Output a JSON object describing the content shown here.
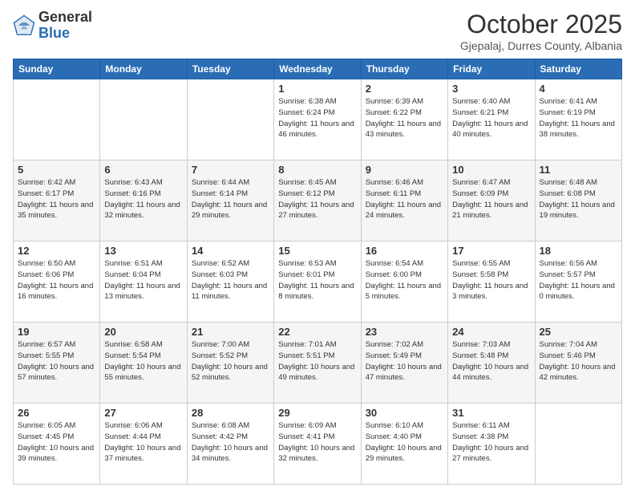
{
  "logo": {
    "general": "General",
    "blue": "Blue"
  },
  "header": {
    "month": "October 2025",
    "location": "Gjepalaj, Durres County, Albania"
  },
  "days_of_week": [
    "Sunday",
    "Monday",
    "Tuesday",
    "Wednesday",
    "Thursday",
    "Friday",
    "Saturday"
  ],
  "weeks": [
    [
      {
        "day": null,
        "data": null
      },
      {
        "day": null,
        "data": null
      },
      {
        "day": null,
        "data": null
      },
      {
        "day": "1",
        "data": "Sunrise: 6:38 AM\nSunset: 6:24 PM\nDaylight: 11 hours and 46 minutes."
      },
      {
        "day": "2",
        "data": "Sunrise: 6:39 AM\nSunset: 6:22 PM\nDaylight: 11 hours and 43 minutes."
      },
      {
        "day": "3",
        "data": "Sunrise: 6:40 AM\nSunset: 6:21 PM\nDaylight: 11 hours and 40 minutes."
      },
      {
        "day": "4",
        "data": "Sunrise: 6:41 AM\nSunset: 6:19 PM\nDaylight: 11 hours and 38 minutes."
      }
    ],
    [
      {
        "day": "5",
        "data": "Sunrise: 6:42 AM\nSunset: 6:17 PM\nDaylight: 11 hours and 35 minutes."
      },
      {
        "day": "6",
        "data": "Sunrise: 6:43 AM\nSunset: 6:16 PM\nDaylight: 11 hours and 32 minutes."
      },
      {
        "day": "7",
        "data": "Sunrise: 6:44 AM\nSunset: 6:14 PM\nDaylight: 11 hours and 29 minutes."
      },
      {
        "day": "8",
        "data": "Sunrise: 6:45 AM\nSunset: 6:12 PM\nDaylight: 11 hours and 27 minutes."
      },
      {
        "day": "9",
        "data": "Sunrise: 6:46 AM\nSunset: 6:11 PM\nDaylight: 11 hours and 24 minutes."
      },
      {
        "day": "10",
        "data": "Sunrise: 6:47 AM\nSunset: 6:09 PM\nDaylight: 11 hours and 21 minutes."
      },
      {
        "day": "11",
        "data": "Sunrise: 6:48 AM\nSunset: 6:08 PM\nDaylight: 11 hours and 19 minutes."
      }
    ],
    [
      {
        "day": "12",
        "data": "Sunrise: 6:50 AM\nSunset: 6:06 PM\nDaylight: 11 hours and 16 minutes."
      },
      {
        "day": "13",
        "data": "Sunrise: 6:51 AM\nSunset: 6:04 PM\nDaylight: 11 hours and 13 minutes."
      },
      {
        "day": "14",
        "data": "Sunrise: 6:52 AM\nSunset: 6:03 PM\nDaylight: 11 hours and 11 minutes."
      },
      {
        "day": "15",
        "data": "Sunrise: 6:53 AM\nSunset: 6:01 PM\nDaylight: 11 hours and 8 minutes."
      },
      {
        "day": "16",
        "data": "Sunrise: 6:54 AM\nSunset: 6:00 PM\nDaylight: 11 hours and 5 minutes."
      },
      {
        "day": "17",
        "data": "Sunrise: 6:55 AM\nSunset: 5:58 PM\nDaylight: 11 hours and 3 minutes."
      },
      {
        "day": "18",
        "data": "Sunrise: 6:56 AM\nSunset: 5:57 PM\nDaylight: 11 hours and 0 minutes."
      }
    ],
    [
      {
        "day": "19",
        "data": "Sunrise: 6:57 AM\nSunset: 5:55 PM\nDaylight: 10 hours and 57 minutes."
      },
      {
        "day": "20",
        "data": "Sunrise: 6:58 AM\nSunset: 5:54 PM\nDaylight: 10 hours and 55 minutes."
      },
      {
        "day": "21",
        "data": "Sunrise: 7:00 AM\nSunset: 5:52 PM\nDaylight: 10 hours and 52 minutes."
      },
      {
        "day": "22",
        "data": "Sunrise: 7:01 AM\nSunset: 5:51 PM\nDaylight: 10 hours and 49 minutes."
      },
      {
        "day": "23",
        "data": "Sunrise: 7:02 AM\nSunset: 5:49 PM\nDaylight: 10 hours and 47 minutes."
      },
      {
        "day": "24",
        "data": "Sunrise: 7:03 AM\nSunset: 5:48 PM\nDaylight: 10 hours and 44 minutes."
      },
      {
        "day": "25",
        "data": "Sunrise: 7:04 AM\nSunset: 5:46 PM\nDaylight: 10 hours and 42 minutes."
      }
    ],
    [
      {
        "day": "26",
        "data": "Sunrise: 6:05 AM\nSunset: 4:45 PM\nDaylight: 10 hours and 39 minutes."
      },
      {
        "day": "27",
        "data": "Sunrise: 6:06 AM\nSunset: 4:44 PM\nDaylight: 10 hours and 37 minutes."
      },
      {
        "day": "28",
        "data": "Sunrise: 6:08 AM\nSunset: 4:42 PM\nDaylight: 10 hours and 34 minutes."
      },
      {
        "day": "29",
        "data": "Sunrise: 6:09 AM\nSunset: 4:41 PM\nDaylight: 10 hours and 32 minutes."
      },
      {
        "day": "30",
        "data": "Sunrise: 6:10 AM\nSunset: 4:40 PM\nDaylight: 10 hours and 29 minutes."
      },
      {
        "day": "31",
        "data": "Sunrise: 6:11 AM\nSunset: 4:38 PM\nDaylight: 10 hours and 27 minutes."
      },
      {
        "day": null,
        "data": null
      }
    ]
  ]
}
